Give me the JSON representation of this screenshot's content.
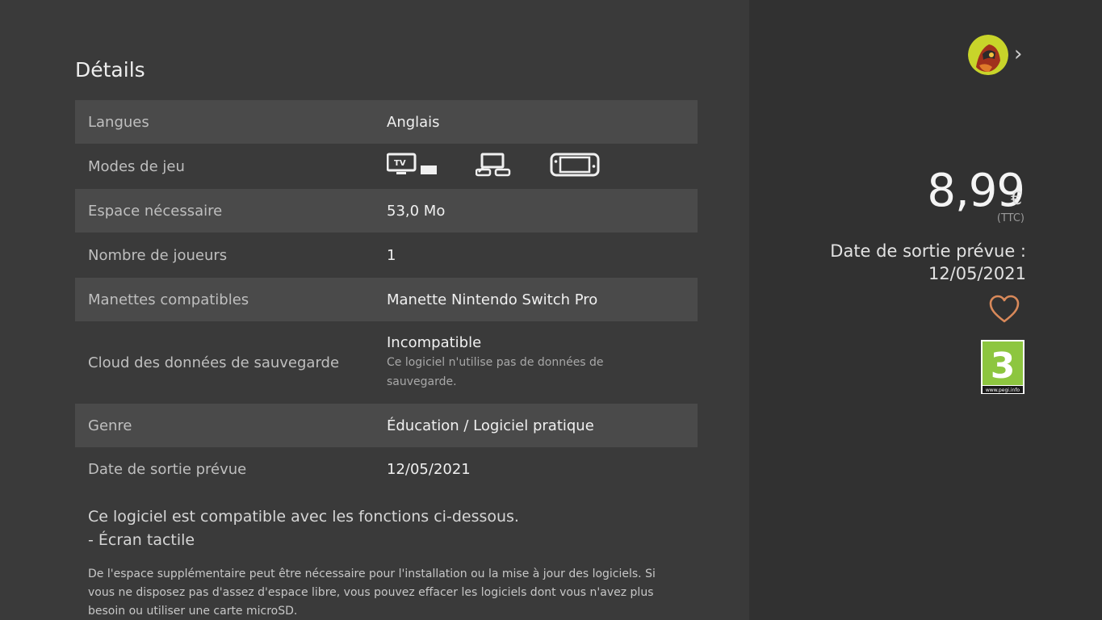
{
  "details": {
    "title": "Détails",
    "rows": [
      {
        "label": "Langues",
        "value": "Anglais"
      },
      {
        "label": "Modes de jeu",
        "modes": [
          "tv-mode-icon",
          "tabletop-mode-icon",
          "handheld-mode-icon"
        ]
      },
      {
        "label": "Espace nécessaire",
        "value": "53,0 Mo"
      },
      {
        "label": "Nombre de joueurs",
        "value": "1"
      },
      {
        "label": "Manettes compatibles",
        "value": "Manette Nintendo Switch Pro"
      },
      {
        "label": "Cloud des données de sauvegarde",
        "value": "Incompatible",
        "sub": "Ce logiciel n'utilise pas de données de sauvegarde."
      },
      {
        "label": "Genre",
        "value": "Éducation / Logiciel pratique"
      },
      {
        "label": "Date de sortie prévue",
        "value": "12/05/2021"
      }
    ],
    "features_line1": "Ce logiciel est compatible avec les fonctions ci-dessous.",
    "features_line2": "- Écran tactile",
    "disclaimer": "De l'espace supplémentaire peut être nécessaire pour l'installation ou la mise à jour des logiciels. Si vous ne disposez pas d'assez d'espace libre, vous pouvez effacer les logiciels dont vous n'avez plus besoin ou utiliser une carte microSD."
  },
  "sidebar": {
    "price": "8,99",
    "currency": "€",
    "tax_note": "(TTC)",
    "release_label": "Date de sortie prévue :",
    "release_date": "12/05/2021",
    "rating_number": "3",
    "rating_site": "www.pegi.info",
    "accent_heart": "#d9895a",
    "pegi_green": "#8dc63f"
  }
}
